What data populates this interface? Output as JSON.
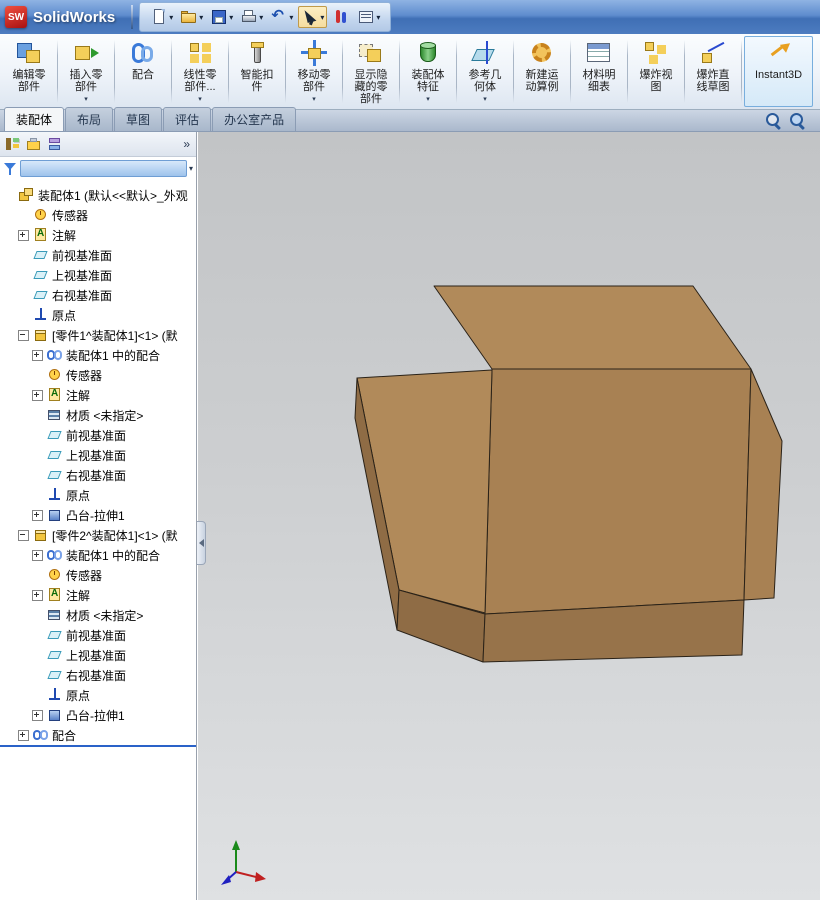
{
  "title_bar": {
    "logo_text": "SW",
    "app_name": "SolidWorks",
    "dropdown_glyph": "▾",
    "toolbar": [
      {
        "id": "new-document",
        "dropdown": true,
        "pressed": false
      },
      {
        "id": "open-folder",
        "dropdown": true,
        "pressed": false
      },
      {
        "id": "save",
        "dropdown": true,
        "pressed": false
      },
      {
        "id": "print",
        "dropdown": true,
        "pressed": false
      },
      {
        "id": "undo",
        "dropdown": true,
        "pressed": false
      },
      {
        "id": "select-arrow",
        "dropdown": true,
        "pressed": true
      },
      {
        "id": "selection-filter",
        "dropdown": false,
        "pressed": false
      },
      {
        "id": "options",
        "dropdown": true,
        "pressed": false
      }
    ]
  },
  "ribbon": {
    "buttons": [
      {
        "id": "edit-component",
        "lines": [
          "编辑零",
          "部件"
        ],
        "dropdown": false,
        "selected": false
      },
      {
        "id": "insert-component",
        "lines": [
          "插入零",
          "部件"
        ],
        "dropdown": true,
        "selected": false
      },
      {
        "id": "mate",
        "lines": [
          "配合"
        ],
        "dropdown": false,
        "selected": false
      },
      {
        "id": "linear-pattern",
        "lines": [
          "线性零",
          "部件..."
        ],
        "dropdown": true,
        "selected": false
      },
      {
        "id": "smart-fasteners",
        "lines": [
          "智能扣",
          "件"
        ],
        "dropdown": false,
        "selected": false
      },
      {
        "id": "move-component",
        "lines": [
          "移动零",
          "部件"
        ],
        "dropdown": true,
        "selected": false
      },
      {
        "id": "show-hidden",
        "lines": [
          "显示隐",
          "藏的零",
          "部件"
        ],
        "dropdown": false,
        "selected": false
      },
      {
        "id": "assembly-features",
        "lines": [
          "装配体",
          "特征"
        ],
        "dropdown": true,
        "selected": false
      },
      {
        "id": "reference-geometry",
        "lines": [
          "参考几",
          "何体"
        ],
        "dropdown": true,
        "selected": false
      },
      {
        "id": "motion-study",
        "lines": [
          "新建运",
          "动算例"
        ],
        "dropdown": false,
        "selected": false
      },
      {
        "id": "bom",
        "lines": [
          "材料明",
          "细表"
        ],
        "dropdown": false,
        "selected": false
      },
      {
        "id": "exploded-view",
        "lines": [
          "爆炸视",
          "图"
        ],
        "dropdown": false,
        "selected": false
      },
      {
        "id": "explode-sketch",
        "lines": [
          "爆炸直",
          "线草图"
        ],
        "dropdown": false,
        "selected": false
      },
      {
        "id": "instant3d",
        "lines": [
          "Instant3D"
        ],
        "dropdown": false,
        "selected": true
      }
    ]
  },
  "tabs": [
    {
      "id": "assembly",
      "label": "装配体",
      "active": true
    },
    {
      "id": "layout",
      "label": "布局",
      "active": false
    },
    {
      "id": "sketch",
      "label": "草图",
      "active": false
    },
    {
      "id": "evaluate",
      "label": "评估",
      "active": false
    },
    {
      "id": "office-products",
      "label": "办公室产品",
      "active": false
    }
  ],
  "panel": {
    "collapse_glyph": "»",
    "header_tabs": [
      "featuremanager",
      "propertymanager",
      "configurationmanager"
    ],
    "filter_value": ""
  },
  "tree": {
    "items": [
      {
        "label": "装配体1 (默认<<默认>_外观",
        "icon": "assembly",
        "level": 0,
        "expander": null
      },
      {
        "label": "传感器",
        "icon": "sensor",
        "level": 1,
        "expander": null
      },
      {
        "label": "注解",
        "icon": "annotations",
        "level": 1,
        "expander": "plus"
      },
      {
        "label": "前视基准面",
        "icon": "plane",
        "level": 1,
        "expander": null
      },
      {
        "label": "上视基准面",
        "icon": "plane",
        "level": 1,
        "expander": null
      },
      {
        "label": "右视基准面",
        "icon": "plane",
        "level": 1,
        "expander": null
      },
      {
        "label": "原点",
        "icon": "origin",
        "level": 1,
        "expander": null
      },
      {
        "label": "[零件1^装配体1]<1> (默",
        "icon": "part",
        "level": 1,
        "expander": "minus"
      },
      {
        "label": "装配体1 中的配合",
        "icon": "mates-in",
        "level": 2,
        "expander": "plus"
      },
      {
        "label": "传感器",
        "icon": "sensor",
        "level": 2,
        "expander": null
      },
      {
        "label": "注解",
        "icon": "annotations",
        "level": 2,
        "expander": "plus"
      },
      {
        "label": "材质 <未指定>",
        "icon": "material",
        "level": 2,
        "expander": null
      },
      {
        "label": "前视基准面",
        "icon": "plane",
        "level": 2,
        "expander": null
      },
      {
        "label": "上视基准面",
        "icon": "plane",
        "level": 2,
        "expander": null
      },
      {
        "label": "右视基准面",
        "icon": "plane",
        "level": 2,
        "expander": null
      },
      {
        "label": "原点",
        "icon": "origin",
        "level": 2,
        "expander": null
      },
      {
        "label": "凸台-拉伸1",
        "icon": "extrude",
        "level": 2,
        "expander": "plus"
      },
      {
        "label": "[零件2^装配体1]<1> (默",
        "icon": "part",
        "level": 1,
        "expander": "minus"
      },
      {
        "label": "装配体1 中的配合",
        "icon": "mates-in",
        "level": 2,
        "expander": "plus"
      },
      {
        "label": "传感器",
        "icon": "sensor",
        "level": 2,
        "expander": null
      },
      {
        "label": "注解",
        "icon": "annotations",
        "level": 2,
        "expander": "plus"
      },
      {
        "label": "材质 <未指定>",
        "icon": "material",
        "level": 2,
        "expander": null
      },
      {
        "label": "前视基准面",
        "icon": "plane",
        "level": 2,
        "expander": null
      },
      {
        "label": "上视基准面",
        "icon": "plane",
        "level": 2,
        "expander": null
      },
      {
        "label": "右视基准面",
        "icon": "plane",
        "level": 2,
        "expander": null
      },
      {
        "label": "原点",
        "icon": "origin",
        "level": 2,
        "expander": null
      },
      {
        "label": "凸台-拉伸1",
        "icon": "extrude",
        "level": 2,
        "expander": "plus"
      },
      {
        "label": "配合",
        "icon": "mates",
        "level": 1,
        "expander": "plus"
      }
    ]
  },
  "viewport": {
    "zoom_buttons": [
      {
        "id": "zoom-in"
      },
      {
        "id": "zoom-area"
      }
    ]
  },
  "model": {
    "top_color": "#b18a5a",
    "mid_color": "#a88153",
    "front_color": "#97734a",
    "dark_color": "#8f6c45",
    "edge_color": "#2a2218",
    "axis_x_color": "#c02020",
    "axis_y_color": "#1a8a1a",
    "axis_z_color": "#2020c0"
  }
}
